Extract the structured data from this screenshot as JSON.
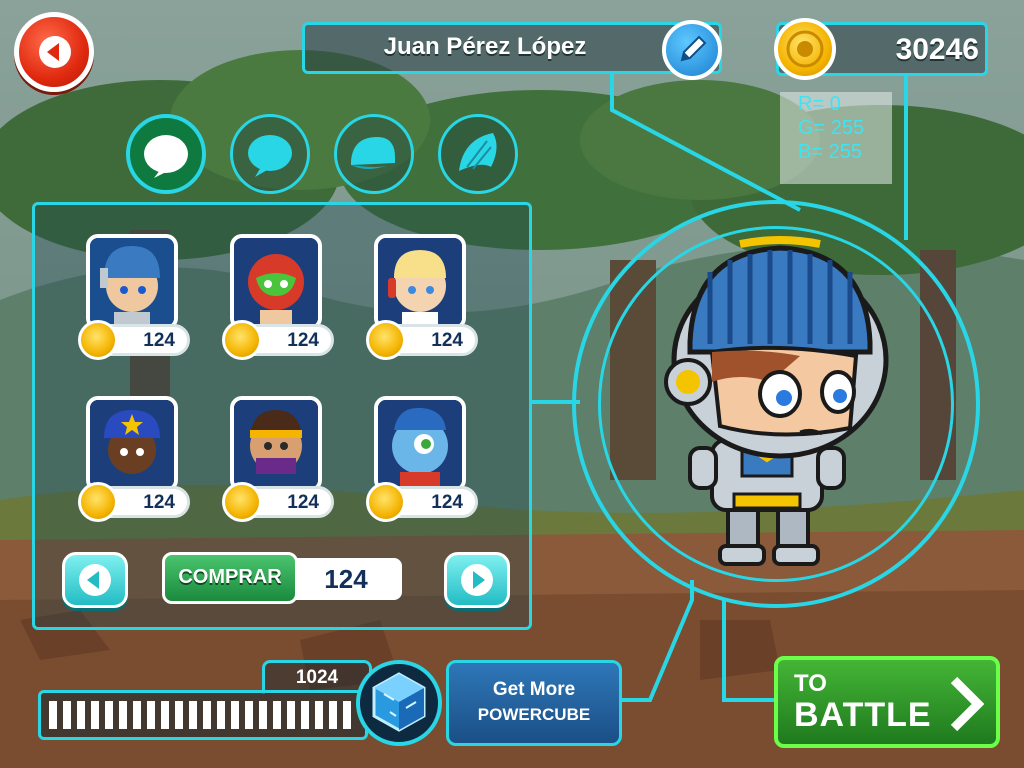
{
  "player": {
    "name": "Juan Pérez López",
    "coins": "30246"
  },
  "debug_color": {
    "r": "R=  0",
    "g": "G= 255",
    "b": "B= 255"
  },
  "category_tabs": [
    {
      "icon": "ball-icon",
      "active": true
    },
    {
      "icon": "ball-icon",
      "active": false
    },
    {
      "icon": "cap-icon",
      "active": false
    },
    {
      "icon": "hair-icon",
      "active": false
    }
  ],
  "characters": [
    {
      "name": "knight",
      "price": "124",
      "color": "#1b4e8f"
    },
    {
      "name": "luchador",
      "price": "124",
      "color": "#1c3f7c"
    },
    {
      "name": "astronaut",
      "price": "124",
      "color": "#1c3f7c"
    },
    {
      "name": "police",
      "price": "124",
      "color": "#1c3f7c"
    },
    {
      "name": "ninja",
      "price": "124",
      "color": "#1c3f7c"
    },
    {
      "name": "cyclops",
      "price": "124",
      "color": "#1c3f7c"
    }
  ],
  "shop": {
    "buy_label": "COMPRAR",
    "buy_price": "124"
  },
  "power": {
    "value": "1024",
    "get_more_line1": "Get More",
    "get_more_line2": "POWERCUBE"
  },
  "battle": {
    "line1": "TO",
    "line2": "BATTLE"
  },
  "colors": {
    "accent": "#29d6e6",
    "coin": "#f4b400",
    "battle_green": "#3aa82e"
  }
}
